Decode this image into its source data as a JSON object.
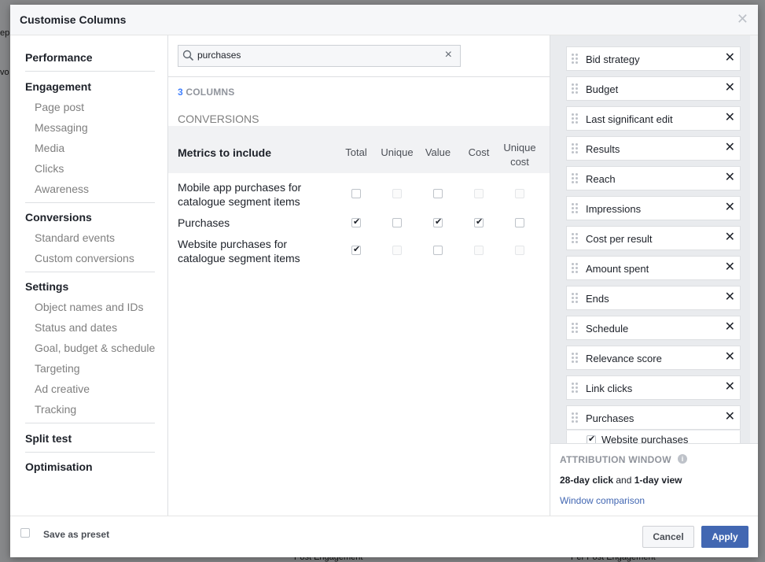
{
  "dialog": {
    "title": "Customise Columns"
  },
  "nav": {
    "performance": "Performance",
    "engagement": "Engagement",
    "engagement_items": [
      "Page post",
      "Messaging",
      "Media",
      "Clicks",
      "Awareness"
    ],
    "conversions": "Conversions",
    "conversion_items": [
      "Standard events",
      "Custom conversions"
    ],
    "settings": "Settings",
    "settings_items": [
      "Object names and IDs",
      "Status and dates",
      "Goal, budget & schedule",
      "Targeting",
      "Ad creative",
      "Tracking"
    ],
    "split_test": "Split test",
    "optimisation": "Optimisation"
  },
  "search": {
    "value": "purchases",
    "clear": "×"
  },
  "results": {
    "count_num": "3",
    "count_label": " COLUMNS",
    "section": "CONVERSIONS",
    "header": {
      "title": "Metrics to include",
      "total": "Total",
      "unique": "Unique",
      "value": "Value",
      "cost": "Cost",
      "unique_cost_1": "Unique",
      "unique_cost_2": "cost"
    },
    "rows": [
      {
        "label": "Mobile app purchases for catalogue segment items",
        "total": false,
        "unique": "disabled",
        "value": false,
        "cost": "disabled",
        "unique_cost": "disabled"
      },
      {
        "label": "Purchases",
        "total": true,
        "unique": false,
        "value": true,
        "cost": true,
        "unique_cost": false
      },
      {
        "label": "Website purchases for catalogue segment items",
        "total": true,
        "unique": "disabled",
        "value": false,
        "cost": "disabled",
        "unique_cost": "disabled"
      }
    ]
  },
  "selected_columns": [
    "Bid strategy",
    "Budget",
    "Last significant edit",
    "Results",
    "Reach",
    "Impressions",
    "Cost per result",
    "Amount spent",
    "Ends",
    "Schedule",
    "Relevance score",
    "Link clicks",
    "Purchases"
  ],
  "purchases_sub": "Website purchases",
  "remove_glyph": "✕",
  "attribution": {
    "title": "ATTRIBUTION WINDOW",
    "info": "i",
    "click": "28-day click",
    "and": " and ",
    "view": "1-day view",
    "link": "Window comparison"
  },
  "footer": {
    "save_preset": "Save as preset",
    "cancel": "Cancel",
    "apply": "Apply"
  },
  "background": {
    "frag1": "ep",
    "frag2": "vo",
    "frag3": "Post Engagement",
    "frag4": "Per Post Engagement"
  },
  "colors": {
    "accent": "#4267b2",
    "count_blue": "#4080ff",
    "muted": "#90949c"
  }
}
